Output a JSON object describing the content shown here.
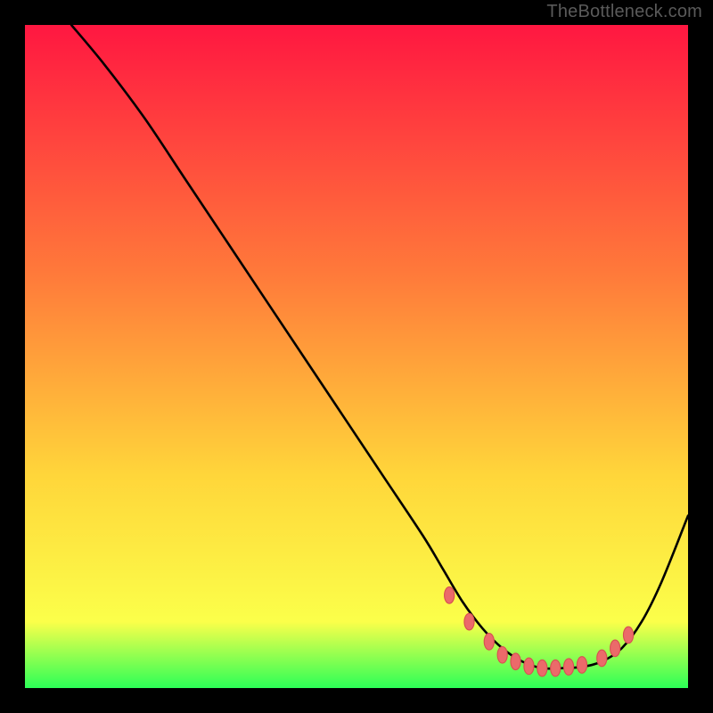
{
  "watermark": "TheBottleneck.com",
  "colors": {
    "frame": "#000000",
    "watermark": "#5a5a5a",
    "gradient_top": "#ff1741",
    "gradient_mid1": "#ff7b3a",
    "gradient_mid2": "#ffd63a",
    "gradient_mid3": "#fbff4a",
    "gradient_bottom": "#2cff57",
    "curve": "#000000",
    "dot_fill": "#eb6a6a",
    "dot_stroke": "#d85050"
  },
  "chart_data": {
    "type": "line",
    "title": "",
    "xlabel": "",
    "ylabel": "",
    "xlim": [
      0,
      100
    ],
    "ylim": [
      0,
      100
    ],
    "series": [
      {
        "name": "curve",
        "x": [
          7,
          12,
          18,
          24,
          30,
          36,
          42,
          48,
          54,
          60,
          63,
          66,
          69,
          72,
          75,
          78,
          81,
          84,
          87,
          90,
          93,
          96,
          100
        ],
        "y": [
          100,
          94,
          86,
          77,
          68,
          59,
          50,
          41,
          32,
          23,
          18,
          13,
          9,
          6,
          4,
          3,
          3,
          3.2,
          4,
          6,
          10,
          16,
          26
        ]
      }
    ],
    "dots": {
      "name": "highlight-dots",
      "x": [
        64,
        67,
        70,
        72,
        74,
        76,
        78,
        80,
        82,
        84,
        87,
        89,
        91
      ],
      "y": [
        14,
        10,
        7,
        5,
        4,
        3.3,
        3,
        3,
        3.2,
        3.5,
        4.5,
        6,
        8
      ]
    }
  }
}
